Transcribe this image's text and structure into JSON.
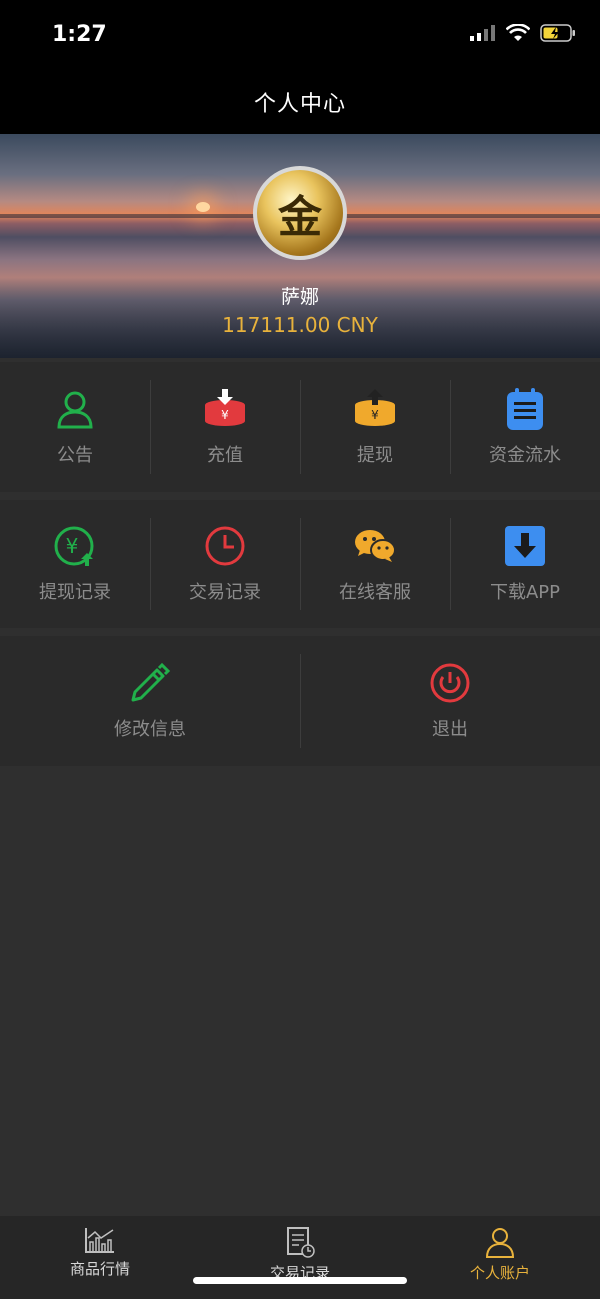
{
  "status_bar": {
    "time": "1:27"
  },
  "nav": {
    "title": "个人中心"
  },
  "profile": {
    "avatar_glyph": "金",
    "name": "萨娜",
    "balance": "117111.00 CNY"
  },
  "menu_row1": [
    {
      "label": "公告",
      "icon": "person-icon",
      "color": "#21b04b"
    },
    {
      "label": "充值",
      "icon": "deposit-icon",
      "color": "#e23a3e"
    },
    {
      "label": "提现",
      "icon": "withdraw-icon",
      "color": "#f0a92c"
    },
    {
      "label": "资金流水",
      "icon": "ledger-icon",
      "color": "#3d8ef0"
    }
  ],
  "menu_row2": [
    {
      "label": "提现记录",
      "icon": "withdraw-record-icon",
      "color": "#21b04b"
    },
    {
      "label": "交易记录",
      "icon": "clock-icon",
      "color": "#e23a3e"
    },
    {
      "label": "在线客服",
      "icon": "wechat-icon",
      "color": "#f0a92c"
    },
    {
      "label": "下载APP",
      "icon": "download-icon",
      "color": "#3d8ef0"
    }
  ],
  "menu_row3": [
    {
      "label": "修改信息",
      "icon": "pencil-icon",
      "color": "#21b04b"
    },
    {
      "label": "退出",
      "icon": "power-icon",
      "color": "#e23a3e"
    }
  ],
  "tabbar": [
    {
      "label": "商品行情",
      "icon": "market-chart-icon",
      "active": false
    },
    {
      "label": "交易记录",
      "icon": "trade-record-icon",
      "active": false
    },
    {
      "label": "个人账户",
      "icon": "account-icon",
      "active": true
    }
  ],
  "colors": {
    "accent": "#e8b23c",
    "background": "#2f2f2f",
    "panel": "#2a2a2a"
  }
}
